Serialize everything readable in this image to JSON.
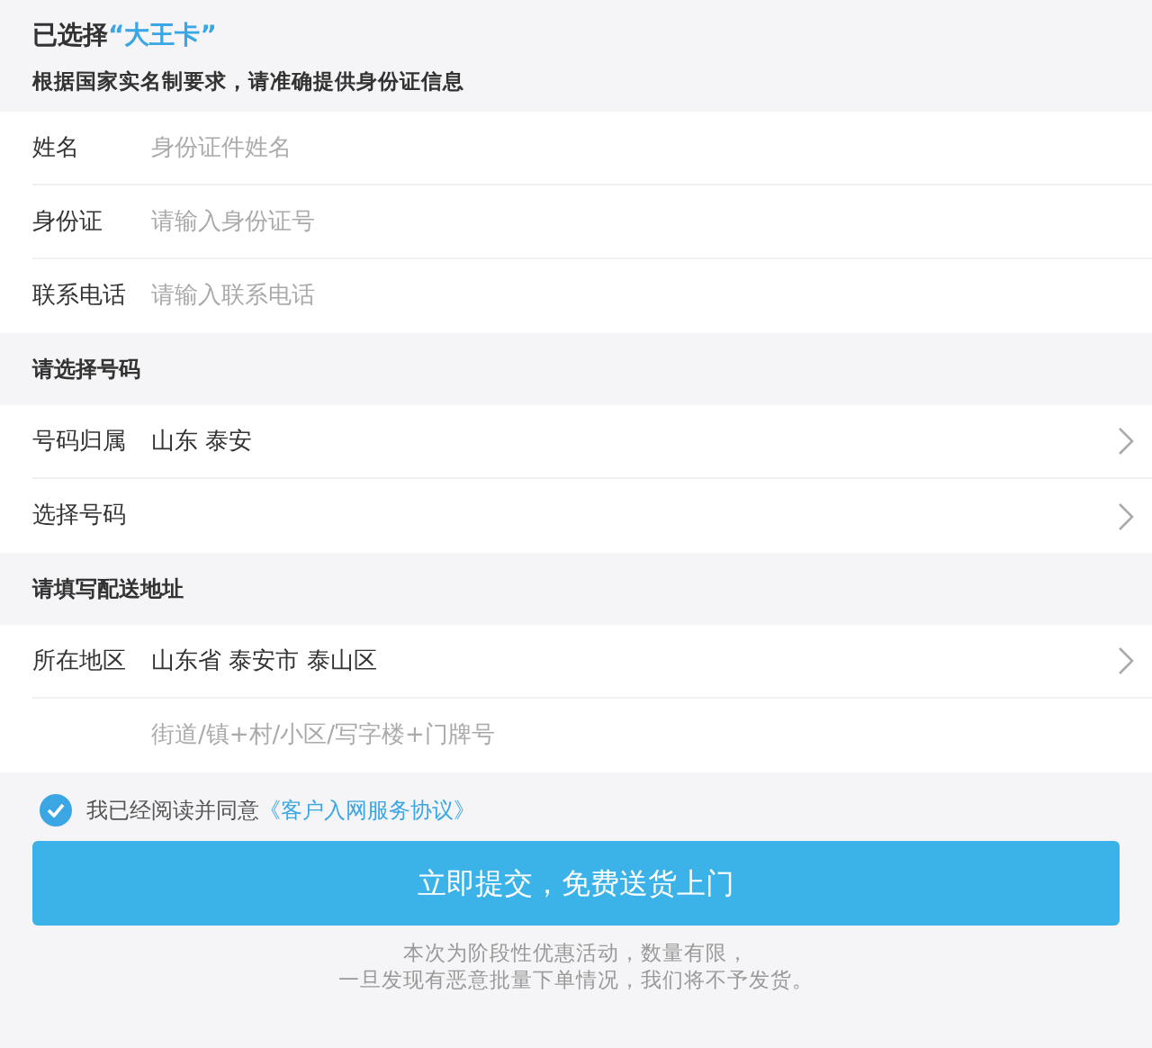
{
  "header": {
    "title": "已选择",
    "card_name": "“大王卡”",
    "subtitle": "根据国家实名制要求，请准确提供身份证信息"
  },
  "sections": [
    {
      "rows": [
        {
          "kind": "input",
          "label": "姓名",
          "placeholder": "身份证件姓名"
        },
        {
          "kind": "input",
          "label": "身份证",
          "placeholder": "请输入身份证号"
        },
        {
          "kind": "input",
          "label": "联系电话",
          "placeholder": "请输入联系电话"
        }
      ]
    },
    {
      "title": "请选择号码",
      "rows": [
        {
          "kind": "select",
          "label": "号码归属",
          "value": "山东 泰安"
        },
        {
          "kind": "select",
          "label": "选择号码"
        }
      ]
    },
    {
      "title": "请填写配送地址",
      "rows": [
        {
          "kind": "select",
          "label": "所在地区",
          "value": "山东省 泰安市 泰山区"
        },
        {
          "kind": "input",
          "placeholder": "街道/镇+村/小区/写字楼+门牌号"
        }
      ]
    }
  ],
  "agreement": {
    "checked": true,
    "text": "我已经阅读并同意",
    "link": "《客户入网服务协议》"
  },
  "submit": "立即提交，免费送货上门",
  "notes": [
    "本次为阶段性优惠活动，数量有限，",
    "一旦发现有恶意批量下单情况，我们将不予发货。"
  ]
}
